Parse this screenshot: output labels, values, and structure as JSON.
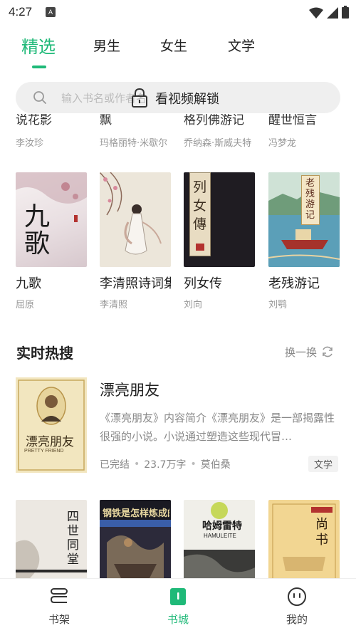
{
  "status_bar": {
    "time": "4:27",
    "app_icon": "A"
  },
  "tabs": [
    {
      "label": "精选",
      "active": true
    },
    {
      "label": "男生",
      "active": false
    },
    {
      "label": "女生",
      "active": false
    },
    {
      "label": "文学",
      "active": false
    }
  ],
  "search": {
    "placeholder": "输入书名或作者名",
    "overlay_text": "看视频解锁"
  },
  "cut_row": [
    {
      "title": "说花影",
      "author": "李汝珍"
    },
    {
      "title": "飘",
      "author": "玛格丽特·米歇尔"
    },
    {
      "title": "格列佛游记",
      "author": "乔纳森·斯威夫特"
    },
    {
      "title": "醒世恒言",
      "author": "冯梦龙"
    }
  ],
  "book_row_1": [
    {
      "title": "九歌",
      "author": "屈原",
      "cover_text": "九歌"
    },
    {
      "title": "李清照诗词集",
      "author": "李清照",
      "cover_text": ""
    },
    {
      "title": "列女传",
      "author": "刘向",
      "cover_text": "列女傳"
    },
    {
      "title": "老残游记",
      "author": "刘鹗",
      "cover_text": "老残游记"
    }
  ],
  "hot_section": {
    "title": "实时热搜",
    "refresh_label": "换一换",
    "item": {
      "title": "漂亮朋友",
      "cover_text": "漂亮朋友",
      "cover_subtext": "PRETTY FRIEND",
      "description": "《漂亮朋友》内容简介《漂亮朋友》是一部揭露性很强的小说。小说通过塑造这些现代冒…",
      "status": "已完结",
      "word_count": "23.7万字",
      "author": "莫伯桑",
      "tag": "文学"
    }
  },
  "book_row_2": [
    {
      "cover_text": "四世同堂"
    },
    {
      "cover_text": "钢铁是怎样炼成的"
    },
    {
      "cover_text": "哈姆雷特",
      "cover_subtext": "HAMULEITE"
    },
    {
      "cover_text": "尚书"
    }
  ],
  "bottom_nav": [
    {
      "label": "书架",
      "icon": "bookshelf-icon",
      "active": false
    },
    {
      "label": "书城",
      "icon": "bookstore-icon",
      "active": true
    },
    {
      "label": "我的",
      "icon": "profile-icon",
      "active": false
    }
  ],
  "colors": {
    "accent": "#1fb978"
  }
}
